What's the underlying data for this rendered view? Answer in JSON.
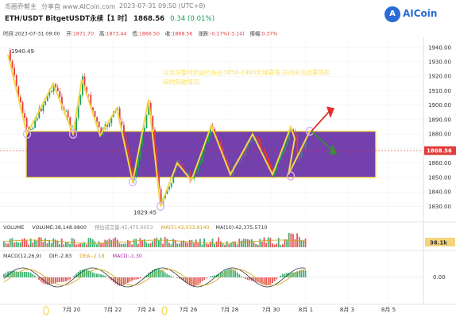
{
  "header": {
    "watermark_site": "币圈乔帮主",
    "watermark_share": "分享自 www.AICoin.com",
    "watermark_time": "2023-07-31 09:50 (UTC+8)",
    "title_pair": "ETH/USDT BitgetUSDT永续【1 时】",
    "title_price": "1868.56",
    "title_change": "0.34 (0.01%)",
    "logo_text": "AICoin",
    "logo_glyph": "A"
  },
  "ohlc_bar": {
    "time": "时间:2023-07-31 09:00",
    "open_label": "开:",
    "open": "1871.70",
    "high_label": "高:",
    "high": "1873.44",
    "low_label": "低:",
    "low": "1866.50",
    "close_label": "收:",
    "close": "1868.56",
    "change_label": "涨跌:",
    "change": "-0.17%(-3.14)",
    "amp_label": "振幅:",
    "amp": "0.37%"
  },
  "annotation": {
    "line1": "以太坊暂时仍运行在在1850-1900区域震荡,日内关注此震荡区",
    "line2": "间的突破情况."
  },
  "price_labels": {
    "high_marker": "1940.49",
    "low_marker": "1829.45",
    "current": "1868.56"
  },
  "volume_bar": {
    "label": "VOLUME",
    "volume": "VOLUME:38,148.9800",
    "estimate": "预估成交量:45,475.6053",
    "ma5": "MA(5):43,033.8140",
    "ma10": "MA(10):42,375.5710",
    "current_tag": "38.1k"
  },
  "macd_bar": {
    "params": "MACD(12,26,9)",
    "dif": "DIF:-2.83",
    "dea": "DEA:-2.18",
    "macd": "MACD:-1.30",
    "zero_tick": "0.00"
  },
  "colors": {
    "zone_fill": "#5b1f9e",
    "zone_border": "#ffe14d",
    "zigzag": "#f2d64a",
    "up_candle": "#1fa35a",
    "down_candle": "#e23b3b",
    "arrow_up": "#e03030",
    "arrow_down": "#3a8d3a",
    "circle_marker": "#d9b3f0"
  },
  "chart_data": {
    "type": "candlestick",
    "timeframe": "1h",
    "price_axis": {
      "ticks": [
        "1940.00",
        "1930.00",
        "1920.00",
        "1910.00",
        "1900.00",
        "1890.00",
        "1880.00",
        "1870.00",
        "1860.00",
        "1850.00",
        "1840.00",
        "1830.00"
      ],
      "range": [
        1822,
        1947
      ]
    },
    "x_axis": {
      "ticks": [
        "7月 20",
        "7月 22",
        "7月 24",
        "7月 26",
        "7月 28",
        "7月 30",
        "8月 1",
        "8月 3",
        "8月 5"
      ]
    },
    "range_zone": {
      "low": 1850,
      "high": 1882
    },
    "extremes": {
      "high": 1940.49,
      "low": 1829.45
    },
    "last_close": 1868.56,
    "zigzag_pattern": {
      "description_points": [
        {
          "label": "7月 19",
          "value": 1935
        },
        {
          "label": "7月 19",
          "value": 1880
        },
        {
          "label": "7月 20",
          "value": 1915
        },
        {
          "label": "7月 20",
          "value": 1880
        },
        {
          "label": "7月 21",
          "value": 1918
        },
        {
          "label": "7月 21",
          "value": 1879
        },
        {
          "label": "7月 22",
          "value": 1898
        },
        {
          "label": "7月 23",
          "value": 1847
        },
        {
          "label": "7月 24",
          "value": 1904
        },
        {
          "label": "7月 24",
          "value": 1830
        },
        {
          "label": "7月 25",
          "value": 1860
        },
        {
          "label": "7月 26",
          "value": 1848
        },
        {
          "label": "7月 26",
          "value": 1886
        },
        {
          "label": "7月 27",
          "value": 1852
        },
        {
          "label": "7月 28",
          "value": 1880
        },
        {
          "label": "7月 28",
          "value": 1852
        },
        {
          "label": "7月 29",
          "value": 1885
        },
        {
          "label": "7月 30",
          "value": 1877
        },
        {
          "label": "7月 30",
          "value": 1852
        },
        {
          "label": "7月 31",
          "value": 1882
        }
      ]
    },
    "volume_axis": {
      "ticks": [
        "38.1k"
      ]
    },
    "macd_axis": {
      "ticks": [
        "0.00"
      ]
    }
  }
}
